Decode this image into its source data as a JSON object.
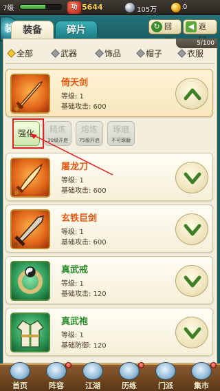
{
  "status_bar": {
    "level": "7级",
    "exp_progress": 0.62,
    "power_label": "功",
    "power_value": "5644",
    "silver_value": "105万",
    "gold_value": "0"
  },
  "header": {
    "emblem": "装",
    "tabs": [
      {
        "label": "装备",
        "active": true
      },
      {
        "label": "碎片",
        "active": false
      }
    ],
    "recycle_label": "回收",
    "back_label": "返回",
    "count": "5/100"
  },
  "filters": [
    {
      "label": "全部",
      "selected": true
    },
    {
      "label": "武器",
      "selected": false
    },
    {
      "label": "饰品",
      "selected": false
    },
    {
      "label": "帽子",
      "selected": false
    },
    {
      "label": "衣服",
      "selected": false
    }
  ],
  "items": [
    {
      "name": "倚天剑",
      "level": "等级: 1",
      "stat": "基础攻击: 600",
      "thumb": "sword-icon",
      "color": "orange",
      "expanded": true
    },
    {
      "name": "屠龙刀",
      "level": "等级: 1",
      "stat": "基础攻击: 600",
      "thumb": "saber-icon",
      "color": "orange",
      "expanded": false
    },
    {
      "name": "玄铁巨剑",
      "level": "等级: 1",
      "stat": "基础攻击: 600",
      "thumb": "greatsword-icon",
      "color": "orange",
      "expanded": false
    },
    {
      "name": "真武戒",
      "level": "等级: 1",
      "stat": "基础攻击: 120",
      "thumb": "ring-icon",
      "color": "green",
      "expanded": false
    },
    {
      "name": "真武袍",
      "level": "等级: 1",
      "stat": "基础防御: 120",
      "thumb": "robe-icon",
      "color": "green",
      "expanded": false
    }
  ],
  "actions": [
    {
      "label": "强化",
      "sub": "",
      "enabled": true
    },
    {
      "label": "精炼",
      "sub": "30级开启",
      "enabled": false
    },
    {
      "label": "熔炼",
      "sub": "75级开启",
      "enabled": false
    },
    {
      "label": "琢磨",
      "sub": "不可琢磨",
      "enabled": false
    }
  ],
  "bottom_nav": [
    {
      "label": "首页",
      "icon": "home-icon",
      "dot": false
    },
    {
      "label": "阵容",
      "icon": "lineup-icon",
      "dot": true
    },
    {
      "label": "江湖",
      "icon": "jianghu-icon",
      "dot": false
    },
    {
      "label": "历练",
      "icon": "training-icon",
      "dot": true
    },
    {
      "label": "门派",
      "icon": "sect-icon",
      "dot": false
    },
    {
      "label": "集市",
      "icon": "market-icon",
      "dot": true
    }
  ],
  "colors": {
    "accent_orange": "#e3560f",
    "accent_green": "#2e8b2e",
    "header_teal": "#23737a",
    "annotation_red": "#e02020"
  }
}
